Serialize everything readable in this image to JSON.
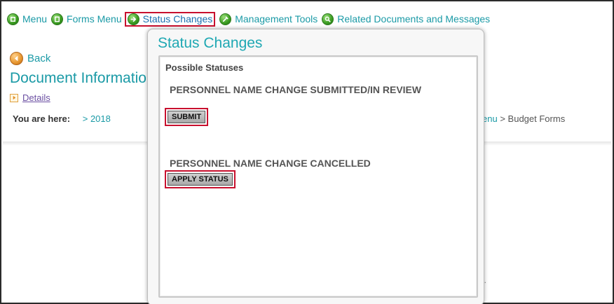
{
  "nav": {
    "items": [
      {
        "label": "Menu",
        "icon": "menu-icon",
        "active": false
      },
      {
        "label": "Forms Menu",
        "icon": "forms-menu-icon",
        "active": false
      },
      {
        "label": "Status Changes",
        "icon": "arrow-right-icon",
        "active": true
      },
      {
        "label": "Management Tools",
        "icon": "tools-icon",
        "active": false
      },
      {
        "label": "Related Documents and Messages",
        "icon": "search-icon",
        "active": false
      }
    ]
  },
  "back_label": "Back",
  "document_title": "Document Information",
  "details_label": "Details",
  "breadcrumb": {
    "label": "You are here:",
    "left_value": "> 2018",
    "right_prefix": "enu",
    "right_sep": ">",
    "right_last": "Budget Forms"
  },
  "background_fragment": "e.",
  "popup": {
    "title": "Status Changes",
    "section_title": "Possible Statuses",
    "statuses": [
      {
        "name": "PERSONNEL NAME CHANGE SUBMITTED/IN REVIEW",
        "button": "SUBMIT"
      },
      {
        "name": "PERSONNEL NAME CHANGE CANCELLED",
        "button": "APPLY STATUS"
      }
    ]
  },
  "colors": {
    "link": "#1a9aa6",
    "highlight_border": "#c8102e",
    "popup_title": "#1fa8b3",
    "visited_link": "#6b4fa2"
  }
}
